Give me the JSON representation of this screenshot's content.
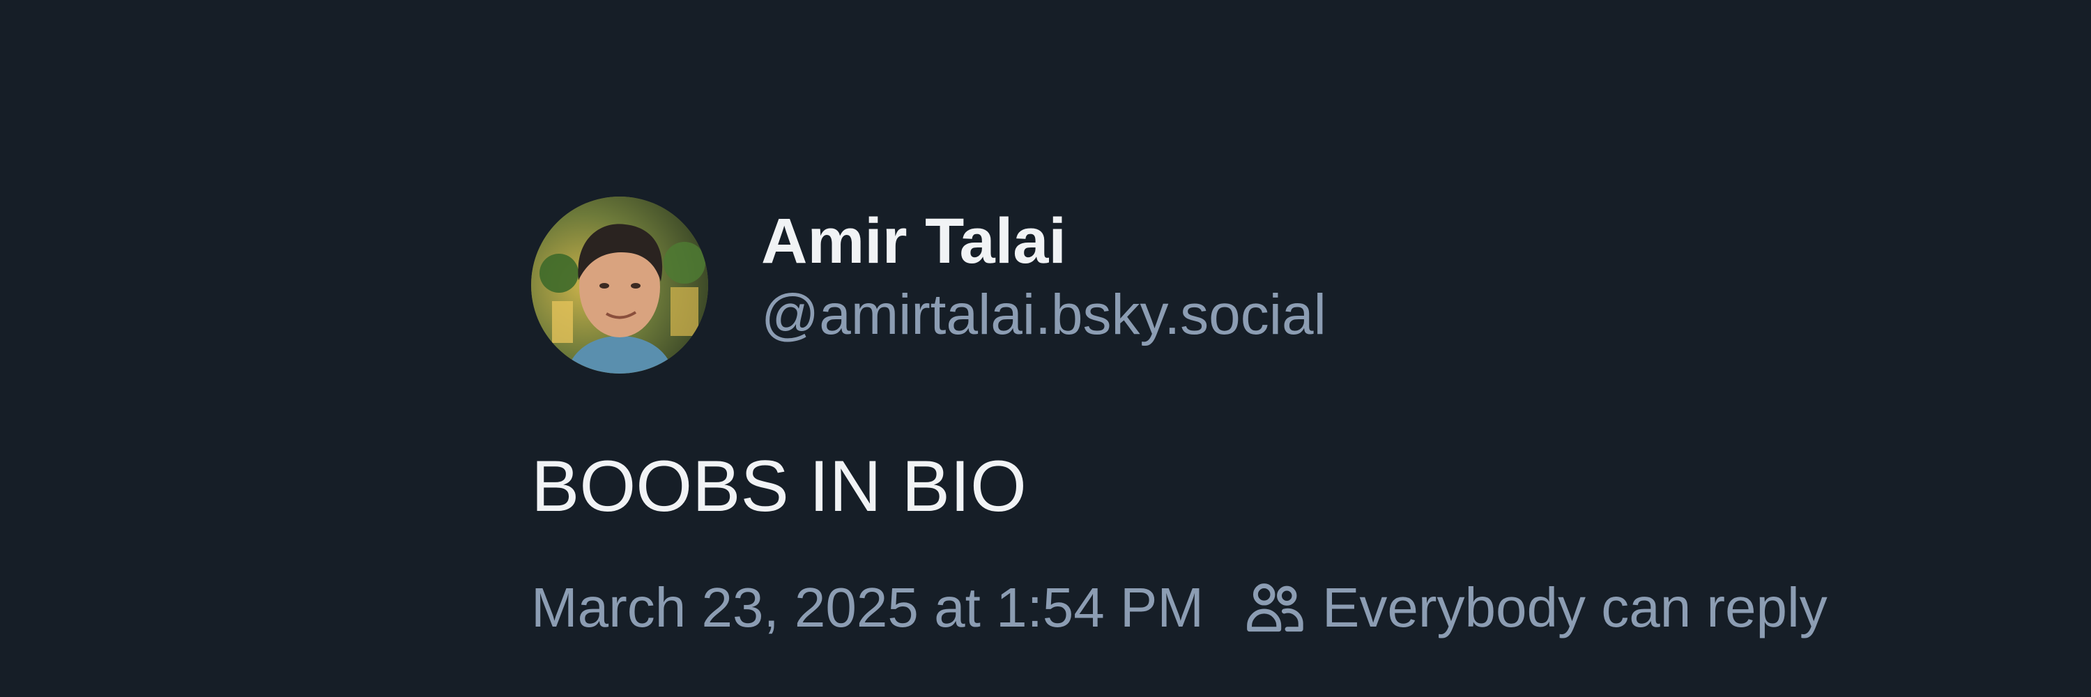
{
  "post": {
    "author": {
      "display_name": "Amir Talai",
      "handle": "@amirtalai.bsky.social",
      "avatar_icon": "profile-photo"
    },
    "text": "BOOBS IN BIO",
    "timestamp": "March 23, 2025 at 1:54 PM",
    "reply_setting": {
      "icon": "people-icon",
      "label": "Everybody can reply"
    }
  },
  "colors": {
    "background": "#161e27",
    "primary_text": "#f1f3f5",
    "secondary_text": "#8c9db3"
  }
}
